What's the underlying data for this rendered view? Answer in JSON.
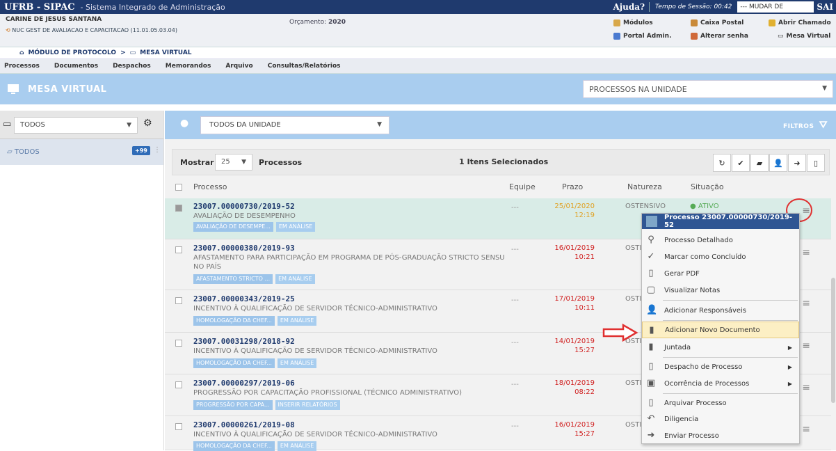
{
  "topbar": {
    "brand": "UFRB - SIPAC",
    "subtitle": "- Sistema Integrado de Administração",
    "help": "Ajuda?",
    "session": "Tempo de Sessão: 00:42",
    "system_select": "--- MUDAR DE SISTEMA ---",
    "exit": "SAI"
  },
  "user": {
    "name": "CARINE DE JESUS SANTANA",
    "unit": "NUC GEST DE AVALIACAO E CAPACITACAO (11.01.05.03.04)",
    "budget_label": "Orçamento:",
    "budget_year": "2020"
  },
  "quicklinks": [
    "Módulos",
    "Caixa Postal",
    "Abrir Chamado",
    "Portal Admin.",
    "Alterar senha",
    "Mesa Virtual"
  ],
  "breadcrumb": [
    "MÓDULO DE PROTOCOLO",
    ">",
    "MESA VIRTUAL"
  ],
  "menu": [
    "Processos",
    "Documentos",
    "Despachos",
    "Memorandos",
    "Arquivo",
    "Consultas/Relatórios"
  ],
  "mesa": {
    "title": "MESA VIRTUAL",
    "select": "PROCESSOS NA UNIDADE"
  },
  "left": {
    "select": "TODOS",
    "tree_item": "TODOS",
    "badge": "+99"
  },
  "main": {
    "user_select": "TODOS DA UNIDADE",
    "filters": "FILTROS"
  },
  "toolbar": {
    "show": "Mostrar",
    "count": "25",
    "processes": "Processos",
    "selected": "1 Itens Selecionados"
  },
  "columns": {
    "process": "Processo",
    "team": "Equipe",
    "deadline": "Prazo",
    "nature": "Natureza",
    "status": "Situação"
  },
  "rows": [
    {
      "num": "23007.00000730/2019-52",
      "desc": "AVALIAÇÃO DE DESEMPENHO",
      "tag1": "AVALIAÇÃO DE DESEMPE...",
      "tag2": "EM ANÁLISE",
      "team": "---",
      "date": "25/01/2020",
      "time": "12:19",
      "nature": "OSTENSIVO",
      "status": "ATIVO"
    },
    {
      "num": "23007.00000380/2019-93",
      "desc": "AFASTAMENTO PARA PARTICIPAÇÃO EM PROGRAMA DE PÓS-GRADUAÇÃO STRICTO SENSU NO PAÍS",
      "tag1": "AFASTAMENTO STRICTO ...",
      "tag2": "EM ANÁLISE",
      "team": "---",
      "date": "16/01/2019",
      "time": "10:21",
      "nature": "OSTI"
    },
    {
      "num": "23007.00000343/2019-25",
      "desc": "INCENTIVO À QUALIFICAÇÃO DE SERVIDOR TÉCNICO-ADMINISTRATIVO",
      "tag1": "HOMOLOGAÇÃO DA CHEF...",
      "tag2": "EM ANÁLISE",
      "team": "---",
      "date": "17/01/2019",
      "time": "10:11",
      "nature": "OSTI"
    },
    {
      "num": "23007.00031298/2018-92",
      "desc": "INCENTIVO À QUALIFICAÇÃO DE SERVIDOR TÉCNICO-ADMINISTRATIVO",
      "tag1": "HOMOLOGAÇÃO DA CHEF...",
      "tag2": "EM ANÁLISE",
      "team": "---",
      "date": "14/01/2019",
      "time": "15:27",
      "nature": "OSTI"
    },
    {
      "num": "23007.00000297/2019-06",
      "desc": "PROGRESSÃO POR CAPACITAÇÃO PROFISSIONAL (TÉCNICO ADMINISTRATIVO)",
      "tag1": "PROGRESSÃO POR CAPA...",
      "tag2": "INSERIR RELATÓRIOS",
      "team": "---",
      "date": "18/01/2019",
      "time": "08:22",
      "nature": "OSTI"
    },
    {
      "num": "23007.00000261/2019-08",
      "desc": "INCENTIVO À QUALIFICAÇÃO DE SERVIDOR TÉCNICO-ADMINISTRATIVO",
      "tag1": "HOMOLOGAÇÃO DA CHEF...",
      "tag2": "EM ANÁLISE",
      "team": "---",
      "date": "16/01/2019",
      "time": "15:27",
      "nature": "OSTI"
    }
  ],
  "context_menu": {
    "header": "Processo 23007.00000730/2019-52",
    "items": [
      "Processo Detalhado",
      "Marcar como Concluído",
      "Gerar PDF",
      "Visualizar Notas",
      "Adicionar Responsáveis",
      "Adicionar Novo Documento",
      "Juntada",
      "Despacho de Processo",
      "Ocorrência de Processos",
      "Arquivar Processo",
      "Diligencia",
      "Enviar Processo"
    ]
  }
}
